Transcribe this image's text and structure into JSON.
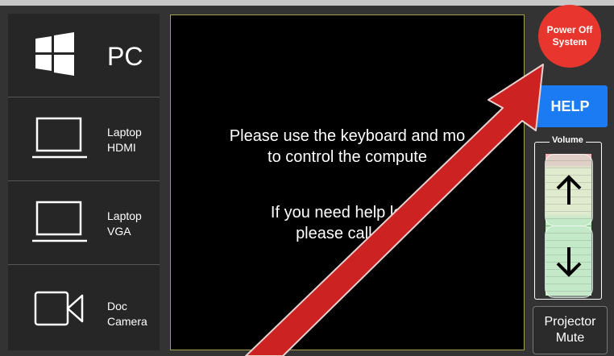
{
  "sources": [
    {
      "label": "PC",
      "icon": "windows-logo-icon"
    },
    {
      "label": "Laptop\nHDMI",
      "icon": "laptop-icon"
    },
    {
      "label": "Laptop\nVGA",
      "icon": "laptop-icon"
    },
    {
      "label": "Doc\nCamera",
      "icon": "video-camera-icon"
    }
  ],
  "panel": {
    "line1": "Please use the keyboard and mo",
    "line2": "to control the compute",
    "line3": "If you need help lo     in,",
    "line4": "please call       57."
  },
  "controls": {
    "power_label": "Power Off\nSystem",
    "help_label": "HELP",
    "volume_label": "Volume",
    "mute_label": "Projector\nMute"
  },
  "colors": {
    "power": "#e8362e",
    "help": "#1a7bf2",
    "arrow": "#cc2222",
    "panel_border": "#a8a047"
  }
}
